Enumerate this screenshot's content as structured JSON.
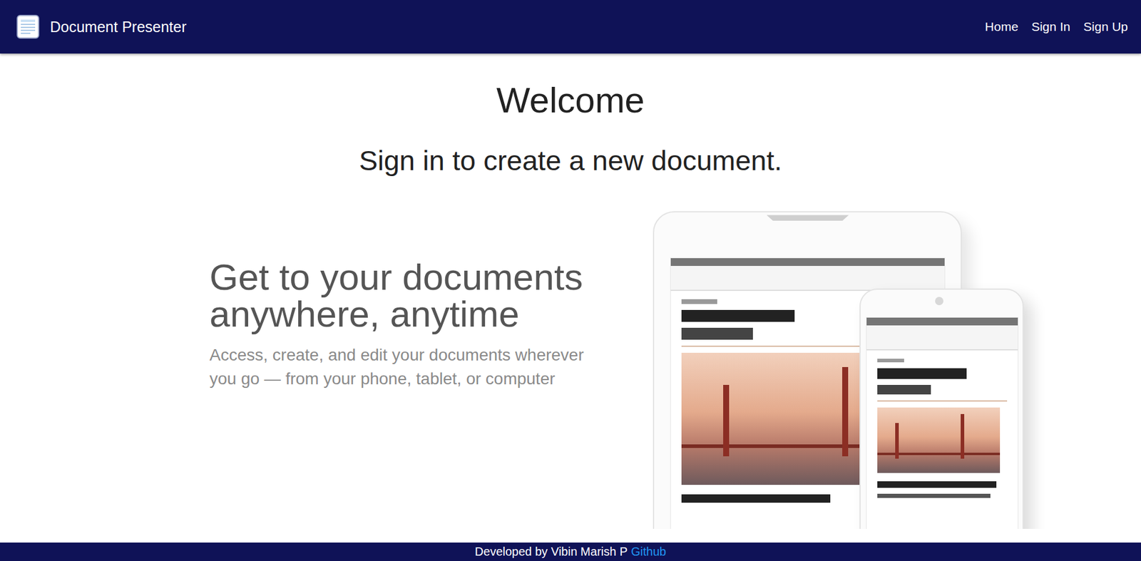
{
  "navbar": {
    "brand": "Document Presenter",
    "links": [
      "Home",
      "Sign In",
      "Sign Up"
    ]
  },
  "welcome": "Welcome",
  "subtitle": "Sign in to create a new document.",
  "hero": {
    "title": "Get to your documents anywhere, anytime",
    "text": "Access, create, and edit your documents wherever you go — from your phone, tablet, or computer"
  },
  "footer": {
    "text": "Developed by Vibin Marish P",
    "link": "Github"
  }
}
